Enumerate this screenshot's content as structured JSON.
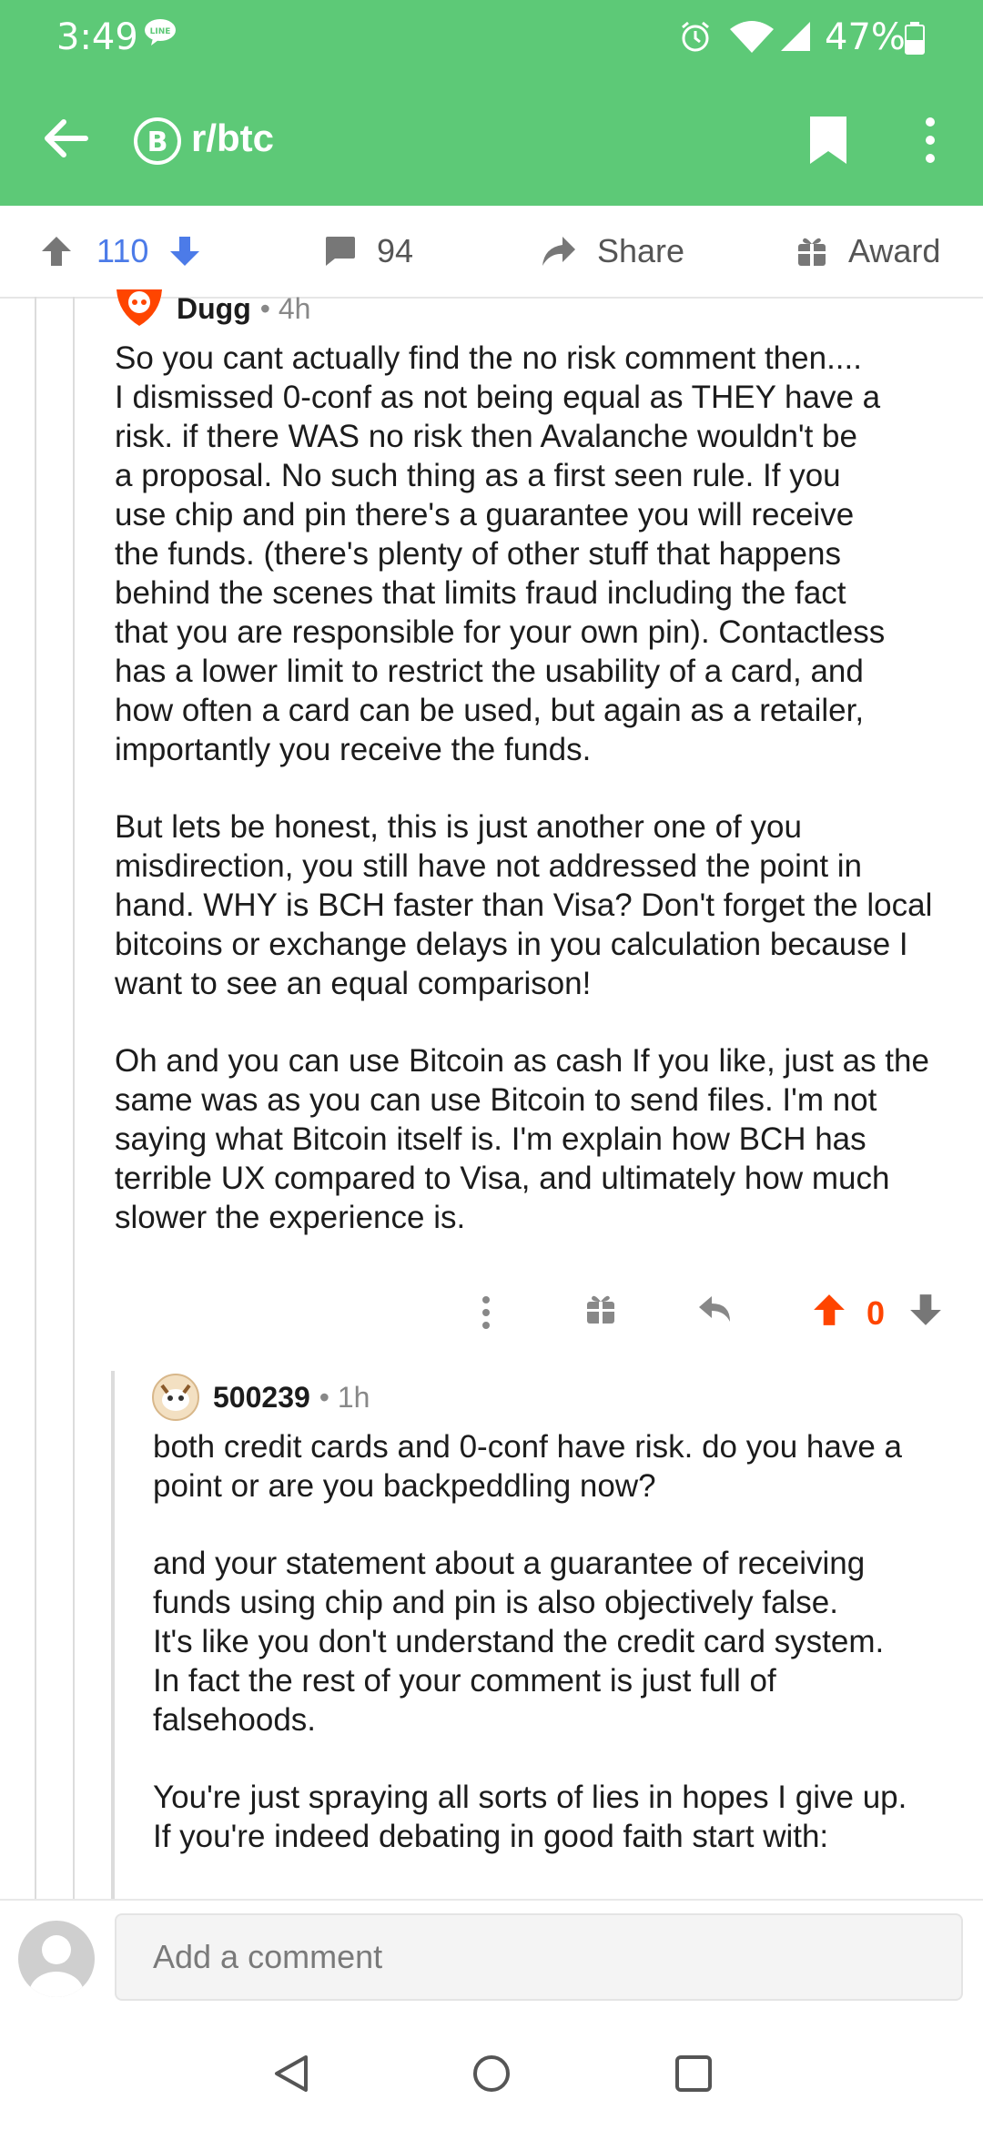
{
  "status": {
    "time": "3:49",
    "battery": "47%"
  },
  "appbar": {
    "subreddit": "r/btc",
    "sub_icon_glyph": "B"
  },
  "actions": {
    "upvotes": "110",
    "comments": "94",
    "share": "Share",
    "award": "Award"
  },
  "comment1": {
    "author": "Dugg",
    "meta": "• 4h",
    "p1": "So you cant actually find the no risk comment then....\nI dismissed 0-conf as not being equal as THEY have a\nrisk. if there WAS no risk then Avalanche wouldn't be\na proposal. No such thing as a first seen rule. If you\nuse chip and pin there's a guarantee you will receive\nthe funds. (there's plenty of other stuff that happens\nbehind the scenes that limits fraud including the fact\nthat you are responsible for your own pin). Contactless\nhas a lower limit to restrict the usability of a card, and\nhow often a card can be used, but again as a retailer,\nimportantly you receive the funds.",
    "p2": "But lets be honest, this is just another one of you\nmisdirection, you still have not addressed the point in\nhand. WHY is BCH faster than Visa? Don't forget the local\nbitcoins or exchange delays in you calculation because I\nwant to see an equal comparison!",
    "p3": "Oh and you can use Bitcoin as cash If you like, just as the\nsame was as you can use Bitcoin to send files. I'm not\nsaying what Bitcoin itself is. I'm explain how BCH has\nterrible UX compared to Visa, and ultimately how much\nslower the experience is.",
    "score": "0"
  },
  "comment2": {
    "author": "500239",
    "meta": "• 1h",
    "p1": "both credit cards and 0-conf have risk. do you have a\npoint or are you backpeddling now?",
    "p2": "and your statement about a guarantee of receiving\nfunds using chip and pin is also objectively false.\nIt's like you don't understand the credit card system.\nIn fact the rest of your comment is just full of\nfalsehoods.",
    "p3": "You're just spraying all sorts of lies in hopes I give up.\nIf you're indeed debating in good faith start with:"
  },
  "compose": {
    "placeholder": "Add a comment"
  },
  "colors": {
    "header": "#5dc977",
    "upvote": "#4c7be8",
    "orangered": "#ff4500"
  }
}
